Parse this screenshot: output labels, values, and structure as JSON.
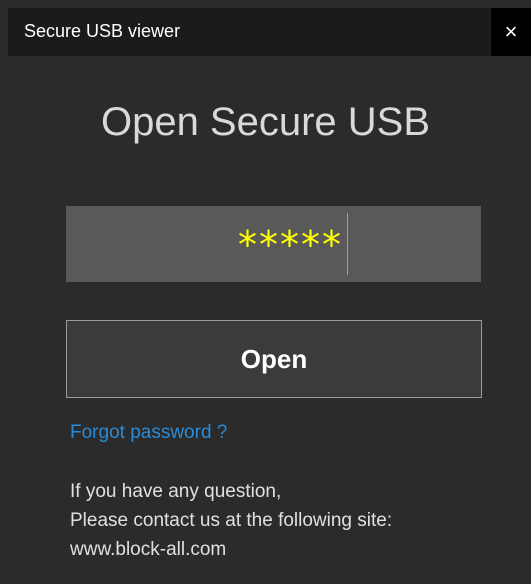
{
  "window": {
    "title": "Secure USB viewer",
    "close_glyph": "×"
  },
  "main": {
    "heading": "Open Secure USB",
    "password_value": "*****",
    "open_label": "Open",
    "forgot_label": "Forgot password ?",
    "info_lines": [
      "If you have any question,",
      "Please contact us at the following site:",
      "www.block-all.com"
    ]
  },
  "colors": {
    "background": "#2b2b2b",
    "titlebar": "#1b1b1b",
    "password_text": "#ffff00",
    "link": "#2b8bd6"
  },
  "icons": {
    "close": "close-icon"
  }
}
